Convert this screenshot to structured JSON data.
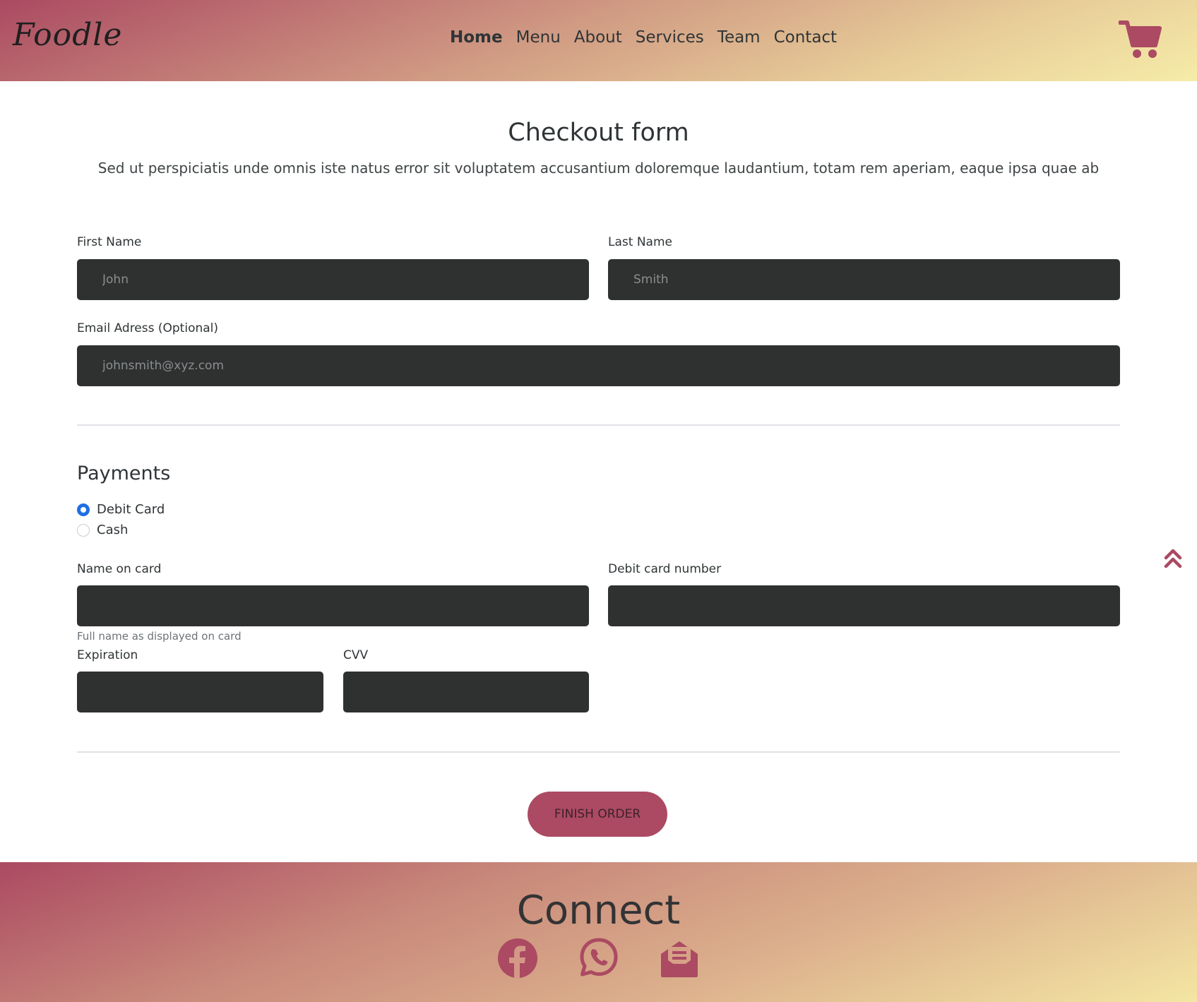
{
  "header": {
    "brand": "Foodle",
    "nav": [
      "Home",
      "Menu",
      "About",
      "Services",
      "Team",
      "Contact"
    ],
    "active_nav": "Home",
    "cart_icon": "shopping-cart-icon"
  },
  "main": {
    "title": "Checkout form",
    "subtitle": "Sed ut perspiciatis unde omnis iste natus error sit voluptatem accusantium doloremque laudantium, totam rem aperiam, eaque ipsa quae ab",
    "first_name": {
      "label": "First Name",
      "placeholder": "John",
      "value": ""
    },
    "last_name": {
      "label": "Last Name",
      "placeholder": "Smith",
      "value": ""
    },
    "email": {
      "label": "Email Adress (Optional)",
      "placeholder": "johnsmith@xyz.com",
      "value": ""
    },
    "payments": {
      "title": "Payments",
      "options": [
        "Debit Card",
        "Cash"
      ],
      "selected": "Debit Card"
    },
    "name_on_card": {
      "label": "Name on card",
      "helper": "Full name as displayed on card",
      "value": ""
    },
    "card_number": {
      "label": "Debit card number",
      "value": ""
    },
    "expiration": {
      "label": "Expiration",
      "value": ""
    },
    "cvv": {
      "label": "CVV",
      "value": ""
    },
    "finish_button": "FINISH ORDER",
    "scroll_top_icon": "double-chevron-up-icon"
  },
  "footer": {
    "title": "Connect",
    "socials": [
      "facebook-icon",
      "whatsapp-icon",
      "mail-open-icon"
    ]
  },
  "colors": {
    "accent": "#ab4a62",
    "input_bg": "#2f3131",
    "radio_checked": "#1f6fe5",
    "gradient_end": "#f6eca8"
  }
}
